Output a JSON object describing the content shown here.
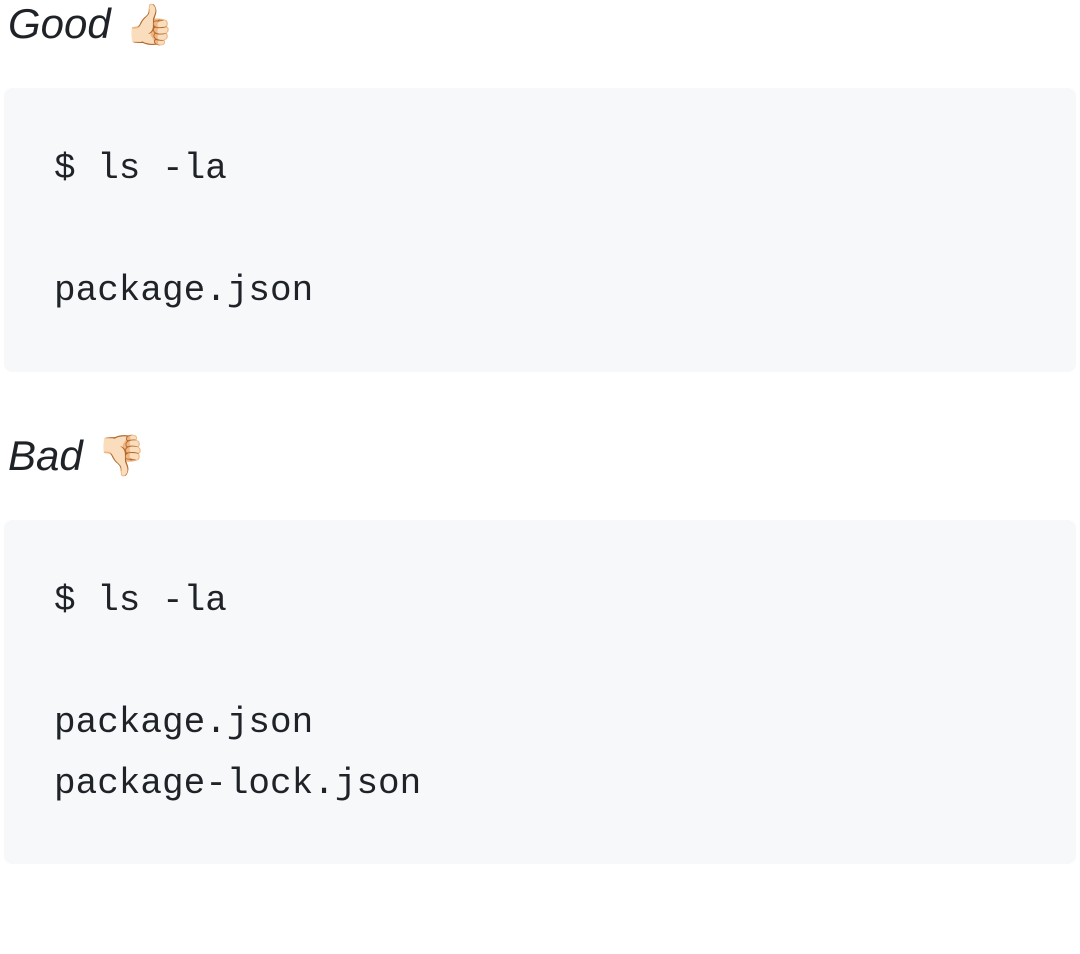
{
  "good": {
    "label": "Good",
    "emoji": "👍🏻",
    "code": "$ ls -la\n\npackage.json"
  },
  "bad": {
    "label": "Bad",
    "emoji": "👎🏻",
    "code": "$ ls -la\n\npackage.json\npackage-lock.json"
  }
}
